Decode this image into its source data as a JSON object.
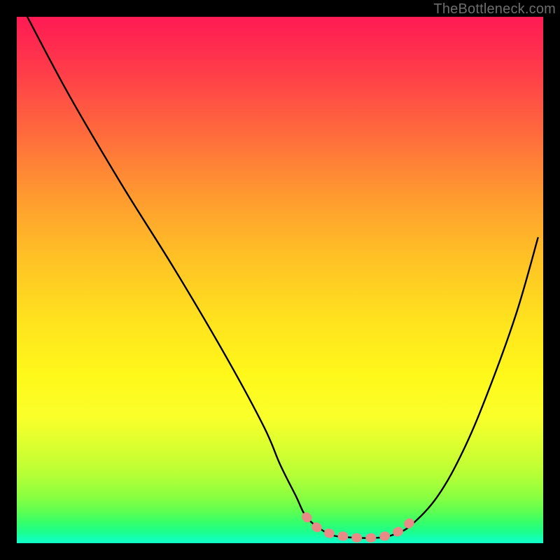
{
  "watermark": "TheBottleneck.com",
  "chart_data": {
    "type": "line",
    "title": "",
    "xlabel": "",
    "ylabel": "",
    "xlim": [
      0,
      100
    ],
    "ylim": [
      0,
      100
    ],
    "grid": false,
    "legend": false,
    "series": [
      {
        "name": "curve",
        "color": "#000000",
        "x": [
          2,
          10,
          20,
          30,
          40,
          47,
          50,
          53,
          55,
          58,
          60,
          62,
          65,
          68,
          70,
          72,
          75,
          80,
          85,
          90,
          95,
          99
        ],
        "values": [
          100,
          85,
          68,
          52,
          35,
          22,
          15,
          9,
          5,
          2.5,
          1.5,
          1.2,
          1.0,
          1.0,
          1.2,
          1.8,
          3.5,
          9,
          18,
          30,
          44,
          58
        ]
      },
      {
        "name": "highlight",
        "color": "#e88a85",
        "style": "thick-dashed",
        "x": [
          55,
          57,
          59,
          61,
          63,
          65,
          67,
          69,
          71,
          73,
          74,
          75
        ],
        "values": [
          5,
          3,
          2,
          1.5,
          1.2,
          1.0,
          1.0,
          1.2,
          1.6,
          2.5,
          3.3,
          4.2
        ]
      }
    ],
    "annotations": [
      {
        "text": "TheBottleneck.com",
        "position": "top-right"
      }
    ]
  }
}
